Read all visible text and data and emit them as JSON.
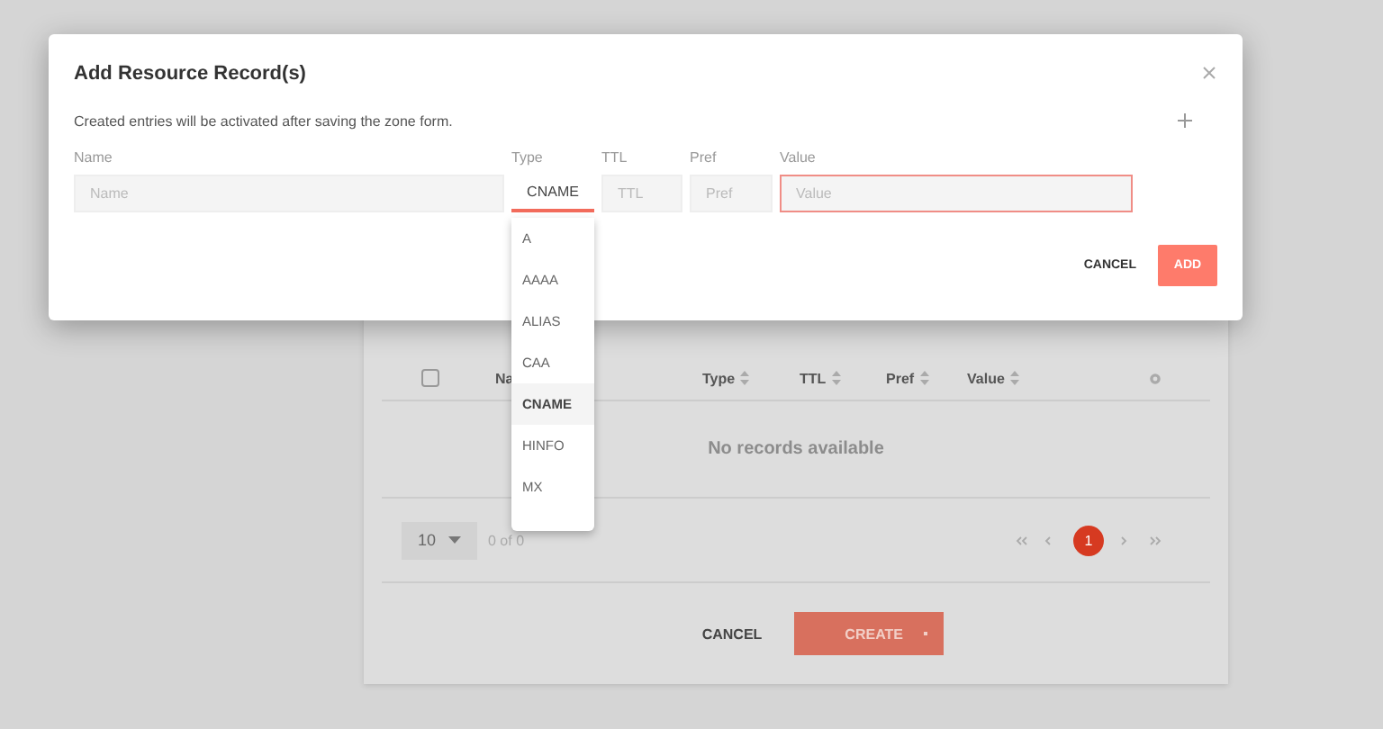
{
  "modal": {
    "title": "Add Resource Record(s)",
    "description": "Created entries will be activated after saving the zone form.",
    "fields": [
      {
        "kind": "text",
        "label": "Name",
        "placeholder": "Name",
        "invalid": false
      },
      {
        "kind": "select",
        "label": "Type",
        "value": "CNAME",
        "focused": true
      },
      {
        "kind": "text",
        "label": "TTL",
        "placeholder": "TTL",
        "invalid": false
      },
      {
        "kind": "text",
        "label": "Pref",
        "placeholder": "Pref",
        "invalid": false
      },
      {
        "kind": "text",
        "label": "Value",
        "placeholder": "Value",
        "invalid": true
      }
    ],
    "buttons": [
      {
        "kind": "flat",
        "label": "CANCEL"
      },
      {
        "kind": "primary",
        "label": "ADD"
      }
    ]
  },
  "type_options": [
    {
      "label": "A",
      "selected": false
    },
    {
      "label": "AAAA",
      "selected": false
    },
    {
      "label": "ALIAS",
      "selected": false
    },
    {
      "label": "CAA",
      "selected": false
    },
    {
      "label": "CNAME",
      "selected": true
    },
    {
      "label": "HINFO",
      "selected": false
    },
    {
      "label": "MX",
      "selected": false
    }
  ],
  "records_table": {
    "select_all": {
      "checked": false
    },
    "columns": [
      {
        "label": "Na"
      },
      {
        "label": "Type"
      },
      {
        "label": "TTL"
      },
      {
        "label": "Pref"
      },
      {
        "label": "Value"
      }
    ],
    "empty_message": "No records available",
    "page_size": "10",
    "range": "0 of 0",
    "pages": [
      {
        "label": "1",
        "selected": true
      }
    ],
    "buttons": [
      {
        "kind": "flat",
        "label": "CANCEL"
      },
      {
        "kind": "split",
        "label": "CREATE"
      }
    ]
  }
}
